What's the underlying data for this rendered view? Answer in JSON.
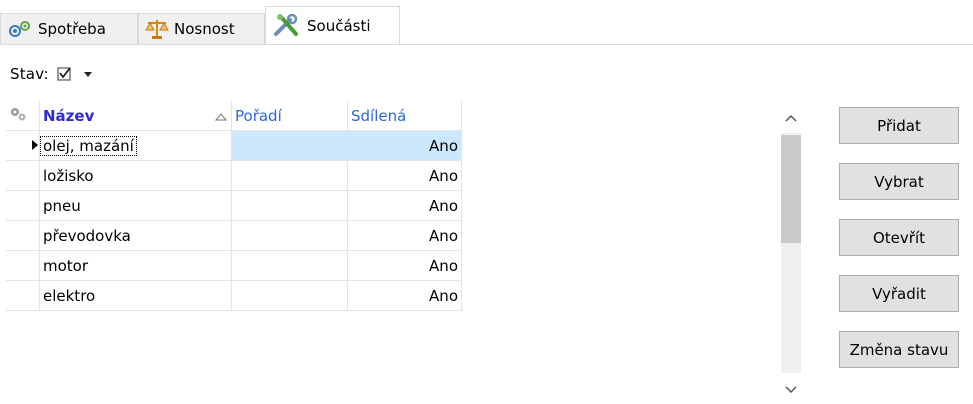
{
  "tabs": [
    {
      "label": "Spotřeba",
      "icon": "gears-icon",
      "active": false
    },
    {
      "label": "Nosnost",
      "icon": "scales-icon",
      "active": false
    },
    {
      "label": "Součásti",
      "icon": "tools-icon",
      "active": true
    }
  ],
  "filter": {
    "label": "Stav:",
    "value_icon": "checkbox-checked-icon"
  },
  "grid": {
    "columns": [
      "Název",
      "Pořadí",
      "Sdílená"
    ],
    "sorted_column": "Název",
    "rows": [
      {
        "name": "olej, mazání",
        "order": "",
        "shared": "Ano",
        "selected": true
      },
      {
        "name": "ložisko",
        "order": "",
        "shared": "Ano",
        "selected": false
      },
      {
        "name": "pneu",
        "order": "",
        "shared": "Ano",
        "selected": false
      },
      {
        "name": "převodovka",
        "order": "",
        "shared": "Ano",
        "selected": false
      },
      {
        "name": "motor",
        "order": "",
        "shared": "Ano",
        "selected": false
      },
      {
        "name": "elektro",
        "order": "",
        "shared": "Ano",
        "selected": false
      }
    ]
  },
  "buttons": {
    "add": "Přidat",
    "select": "Vybrat",
    "open": "Otevřít",
    "retire": "Vyřadit",
    "change_state": "Změna stavu"
  },
  "colors": {
    "header_text": "#2f67d8",
    "selection": "#cce8ff",
    "tab_inactive_bg": "#f0f0f0",
    "button_bg": "#e1e1e1"
  }
}
